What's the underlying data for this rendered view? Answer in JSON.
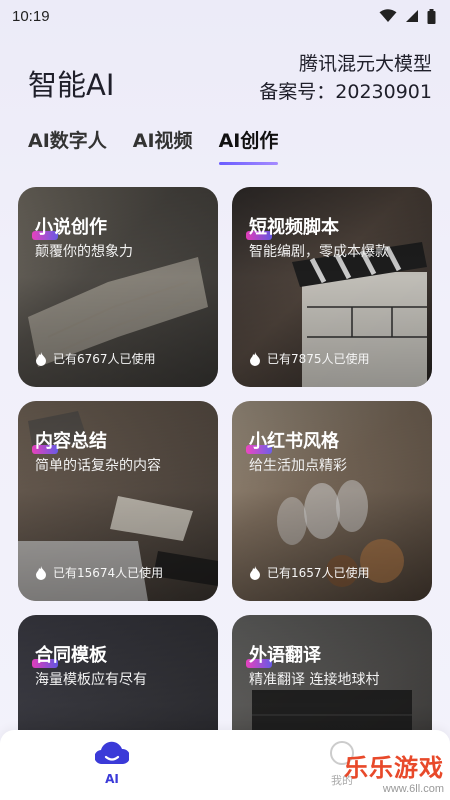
{
  "status_bar": {
    "time": "10:19"
  },
  "header": {
    "app_title": "智能AI",
    "model_name": "腾讯混元大模型",
    "filing_number": "备案号：20230901"
  },
  "tabs": [
    {
      "label": "AI数字人",
      "active": false
    },
    {
      "label": "AI视频",
      "active": false
    },
    {
      "label": "AI创作",
      "active": true
    }
  ],
  "cards": [
    {
      "title": "小说创作",
      "subtitle": "颠覆你的想象力",
      "usage": "已有6767人已使用"
    },
    {
      "title": "短视频脚本",
      "subtitle": "智能编剧，零成本爆款",
      "usage": "已有7875人已使用"
    },
    {
      "title": "内容总结",
      "subtitle": "简单的话复杂的内容",
      "usage": "已有15674人已使用"
    },
    {
      "title": "小红书风格",
      "subtitle": "给生活加点精彩",
      "usage": "已有1657人已使用"
    },
    {
      "title": "合同模板",
      "subtitle": "海量模板应有尽有",
      "usage": ""
    },
    {
      "title": "外语翻译",
      "subtitle": "精准翻译 连接地球村",
      "usage": ""
    }
  ],
  "bottom_nav": {
    "items": [
      {
        "label": "AI",
        "icon": "cloud-icon",
        "active": true
      },
      {
        "label": "我的",
        "icon": "user-icon",
        "active": false
      }
    ]
  },
  "watermark": {
    "text": "乐乐游戏",
    "url": "www.6ll.com"
  },
  "colors": {
    "accent": "#3b3ad8",
    "tab_underline": "#6a5cff",
    "title_accent": "#ff3fd0",
    "watermark": "#e8492a"
  }
}
